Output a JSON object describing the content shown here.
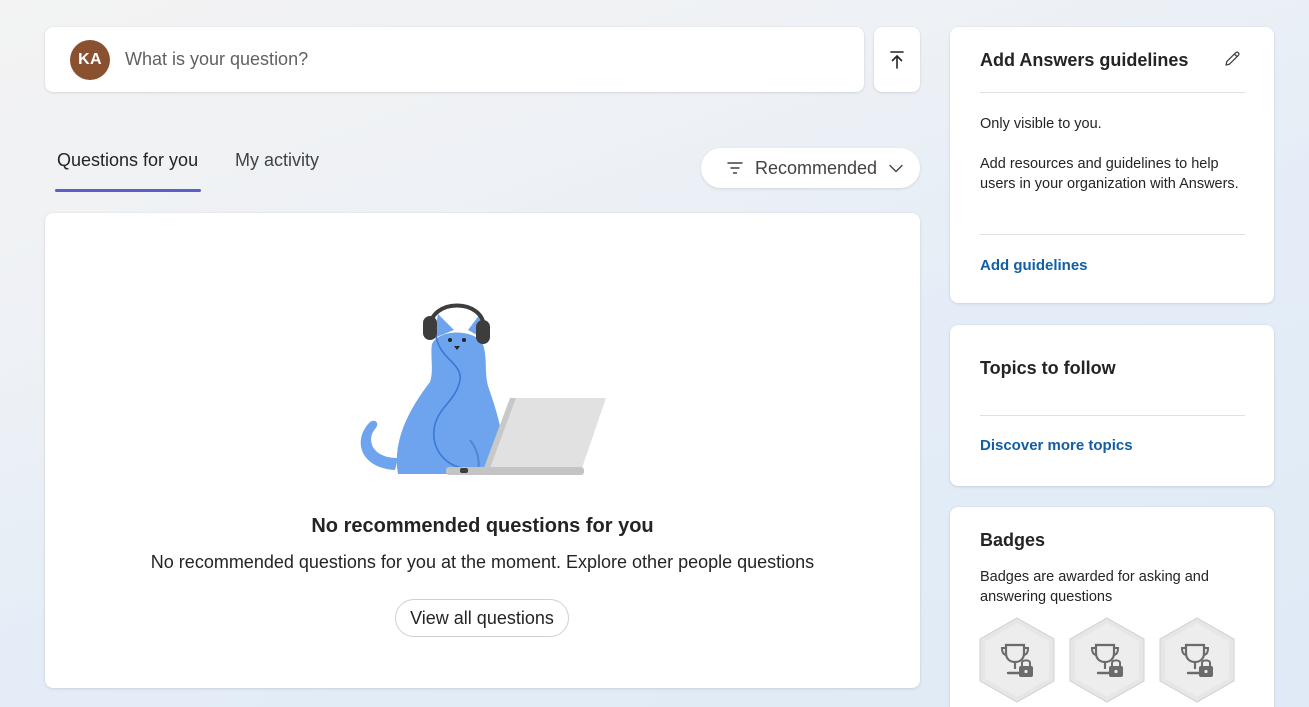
{
  "ask_bar": {
    "avatar_initials": "KA",
    "avatar_color": "#8a5130",
    "placeholder": "What is your question?"
  },
  "tabs": [
    {
      "label": "Questions for you",
      "selected": true
    },
    {
      "label": "My activity",
      "selected": false
    }
  ],
  "sort": {
    "label": "Recommended",
    "icon": "filter-icon"
  },
  "main": {
    "empty_title": "No recommended questions for you",
    "empty_desc": "No recommended questions for you at the moment. Explore other people questions",
    "view_all_label": "View all questions"
  },
  "guidelines": {
    "title": "Add Answers guidelines",
    "visibility": "Only visible to you.",
    "desc": "Add resources and guidelines to help users in your organization with Answers.",
    "link": "Add guidelines"
  },
  "topics": {
    "title": "Topics to follow",
    "link": "Discover more topics"
  },
  "badges": {
    "title": "Badges",
    "desc": "Badges are awarded for asking and answering questions",
    "items": [
      {
        "icon": "locked-trophy-icon"
      },
      {
        "icon": "locked-trophy-icon"
      },
      {
        "icon": "locked-trophy-icon"
      }
    ]
  },
  "colors": {
    "accent": "#5b5fc7",
    "link": "#115ea3",
    "cat": "#6ea4ee"
  }
}
